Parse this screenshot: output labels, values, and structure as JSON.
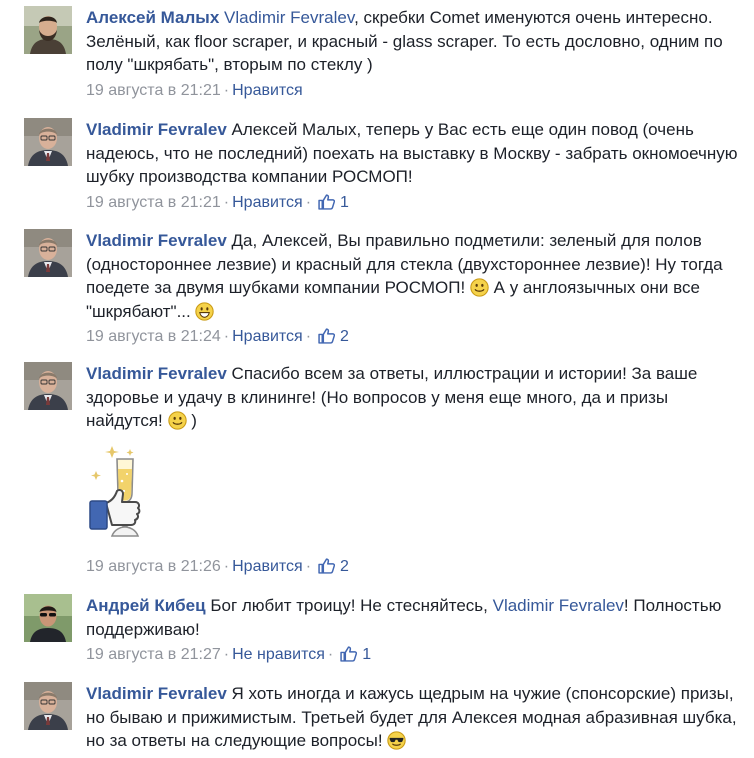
{
  "comments": [
    {
      "author": "Алексей Малых",
      "mention": "Vladimir Fevralev",
      "text": ", скребки Comet именуются очень интересно. Зелёный, как floor scraper, и красный - glass scraper. То есть дословно, одним по полу \"шкрябать\", вторым по стеклу )",
      "time": "19 августа в 21:21",
      "like_label": "Нравится",
      "likes": ""
    },
    {
      "author": "Vladimir Fevralev",
      "text": "Алексей Малых, теперь у Вас есть еще один повод (очень надеюсь, что не последний) поехать на выставку в Москву - забрать окномоечную шубку производства компании РОСМОП!",
      "time": "19 августа в 21:21",
      "like_label": "Нравится",
      "likes": "1"
    },
    {
      "author": "Vladimir Fevralev",
      "text_a": "Да, Алексей, Вы правильно подметили: зеленый для полов (одностороннее лезвие) и красный для стекла (двухстороннее лезвие)! Ну тогда поедете за двумя шубками компании РОСМОП!",
      "text_b": "А у англоязычных они все \"шкрябают\"...",
      "time": "19 августа в 21:24",
      "like_label": "Нравится",
      "likes": "2"
    },
    {
      "author": "Vladimir Fevralev",
      "text_a": "Спасибо всем за ответы, иллюстрации и истории! За ваше здоровье и удачу в клининге! (Но вопросов у меня еще много, да и призы найдутся!",
      "text_b": ")",
      "time": "19 августа в 21:26",
      "like_label": "Нравится",
      "likes": "2"
    },
    {
      "author": "Андрей Кибец",
      "text_a": "Бог любит троицу! Не стесняйтесь,",
      "mention": "Vladimir Fevralev",
      "text_b": "! Полностью поддерживаю!",
      "time": "19 августа в 21:27",
      "like_label": "Не нравится",
      "likes": "1"
    },
    {
      "author": "Vladimir Fevralev",
      "text": "Я хоть иногда и кажусь щедрым на чужие (спонсорские) призы, но бываю и прижимистым. Третьей будет для Алексея модная абразивная шубка, но за ответы на следующие вопросы!"
    }
  ],
  "separator": "·",
  "colors": {
    "link": "#365899",
    "meta": "#90949c",
    "text": "#1d2129",
    "thumb": "#4267b2"
  }
}
